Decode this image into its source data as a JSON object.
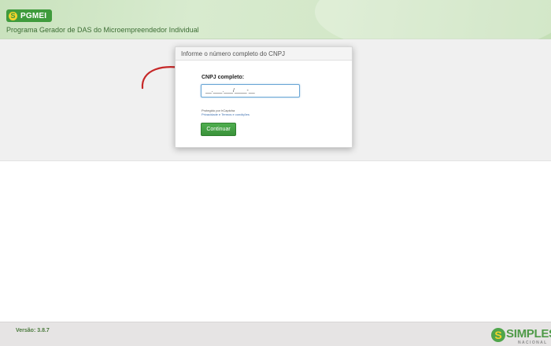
{
  "header": {
    "logo_initial": "S",
    "logo_text": "PGMEI",
    "subtitle": "Programa Gerador de DAS do Microempreendedor Individual"
  },
  "dialog": {
    "title": "Informe o número completo do CNPJ",
    "field_label": "CNPJ completo:",
    "input_value": "__.___.___/____-__",
    "captcha_text": "Protegido por hCaptcha",
    "captcha_links": "Privacidade e Termos e condições",
    "continue_label": "Continuar"
  },
  "footer": {
    "version": "Versão: 3.8.7",
    "logo_initial": "S",
    "logo_word": "SIMPLES",
    "logo_sub": "NACIONAL"
  },
  "colors": {
    "brand_green": "#3f9b3c",
    "logo_yellow": "#f3d22b",
    "arrow_red": "#c62828"
  },
  "icons": {
    "arrow": "curved-arrow-icon",
    "app_logo": "pgmei-logo-icon",
    "footer_logo": "simples-nacional-logo-icon"
  }
}
